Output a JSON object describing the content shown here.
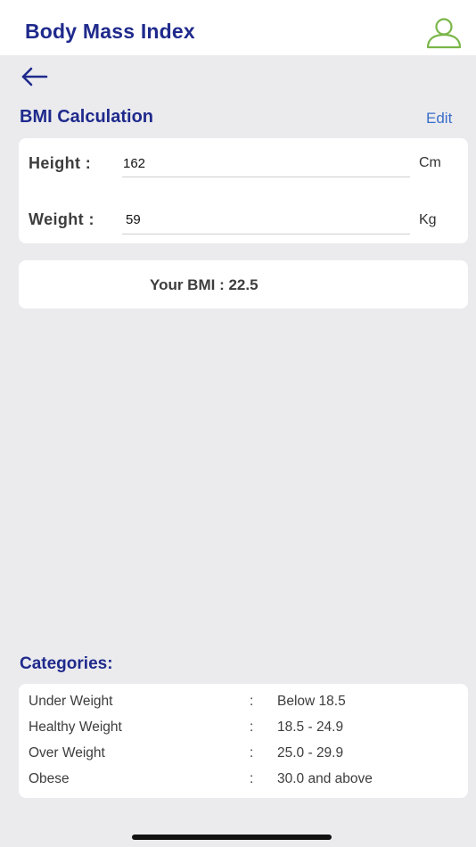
{
  "header": {
    "title": "Body Mass Index",
    "profile_icon": "user-outline-icon",
    "accent_color": "#7ab648"
  },
  "navigation": {
    "back_icon": "arrow-left-icon"
  },
  "calculation": {
    "title": "BMI Calculation",
    "edit_label": "Edit",
    "height": {
      "label": "Height :",
      "value": "162",
      "unit": "Cm"
    },
    "weight": {
      "label": "Weight :",
      "value": "59",
      "unit": "Kg"
    }
  },
  "result": {
    "text": "Your BMI : 22.5"
  },
  "categories": {
    "title": "Categories:",
    "items": [
      {
        "name": "Under Weight",
        "sep": ":",
        "range": "Below 18.5"
      },
      {
        "name": "Healthy Weight",
        "sep": ":",
        "range": "18.5 - 24.9"
      },
      {
        "name": "Over Weight",
        "sep": ":",
        "range": "25.0 - 29.9"
      },
      {
        "name": "Obese",
        "sep": ":",
        "range": "30.0 and above"
      }
    ]
  },
  "colors": {
    "primary": "#1f2a8c",
    "link": "#3a6fc9",
    "background": "#ebebee"
  }
}
